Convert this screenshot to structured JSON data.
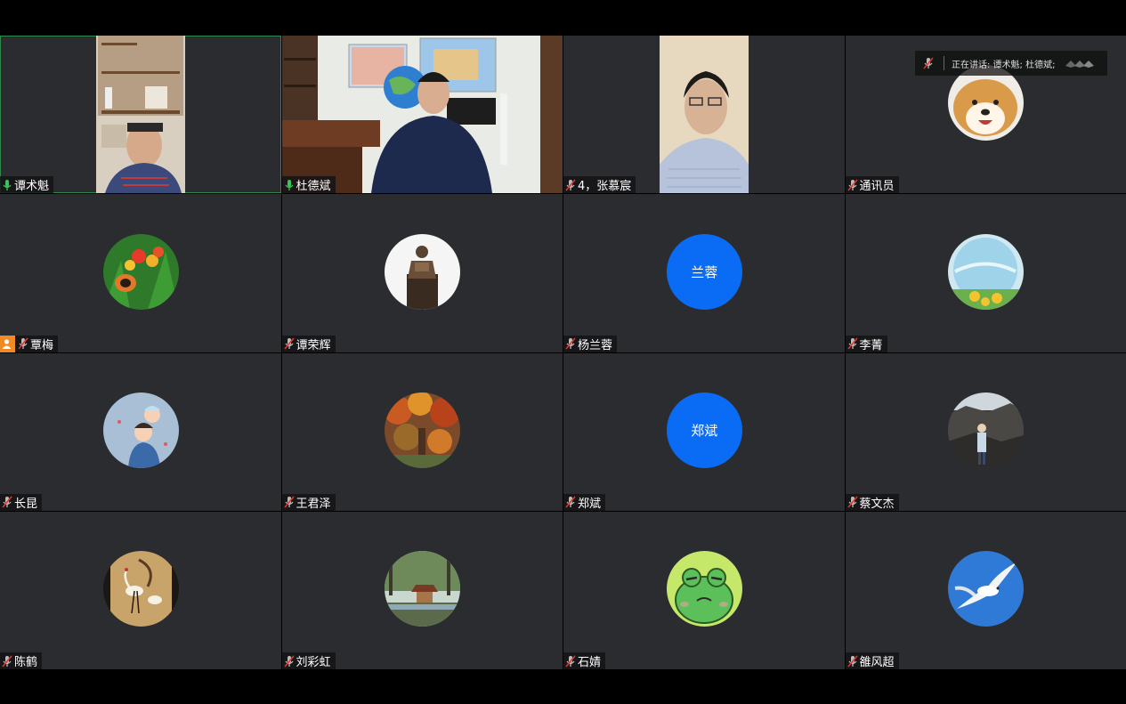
{
  "speaking_indicator": {
    "label": "正在讲话: 谭术魁; 杜德斌;",
    "icon": "speaker-muted-icon"
  },
  "colors": {
    "tile_bg": "#2b2c2f",
    "active_border": "#2d8a4a",
    "mic_on": "#3cc35a",
    "mic_off": "#e0362c",
    "text_avatar_bg": "#0a6cf5",
    "host_badge": "#f08a24"
  },
  "participants": [
    {
      "name": "谭术魁",
      "mic": "on",
      "type": "video",
      "active": true
    },
    {
      "name": "杜德斌",
      "mic": "on",
      "type": "video"
    },
    {
      "name": "4，张慕宸",
      "mic": "off",
      "type": "video"
    },
    {
      "name": "通讯员",
      "mic": "off",
      "type": "avatar",
      "avatar": "shiba-dog-avatar"
    },
    {
      "name": "覃梅",
      "mic": "off",
      "type": "avatar",
      "avatar": "flower-butterfly-avatar",
      "host": true
    },
    {
      "name": "谭荣辉",
      "mic": "off",
      "type": "avatar",
      "avatar": "statue-avatar"
    },
    {
      "name": "杨兰蓉",
      "mic": "off",
      "type": "text-avatar",
      "initials": "兰蓉"
    },
    {
      "name": "李菁",
      "mic": "off",
      "type": "avatar",
      "avatar": "crystal-ball-sunflower-avatar"
    },
    {
      "name": "长昆",
      "mic": "off",
      "type": "avatar",
      "avatar": "cartoon-family-avatar"
    },
    {
      "name": "王君泽",
      "mic": "off",
      "type": "avatar",
      "avatar": "autumn-trees-avatar"
    },
    {
      "name": "郑斌",
      "mic": "off",
      "type": "text-avatar",
      "initials": "郑斌"
    },
    {
      "name": "蔡文杰",
      "mic": "off",
      "type": "avatar",
      "avatar": "person-rocks-avatar"
    },
    {
      "name": "陈鹤",
      "mic": "off",
      "type": "avatar",
      "avatar": "crane-painting-avatar"
    },
    {
      "name": "刘彩虹",
      "mic": "off",
      "type": "avatar",
      "avatar": "pavilion-garden-avatar"
    },
    {
      "name": "石婧",
      "mic": "off",
      "type": "avatar",
      "avatar": "frog-cartoon-avatar"
    },
    {
      "name": "雒风超",
      "mic": "off",
      "type": "avatar",
      "avatar": "seagull-avatar"
    }
  ]
}
